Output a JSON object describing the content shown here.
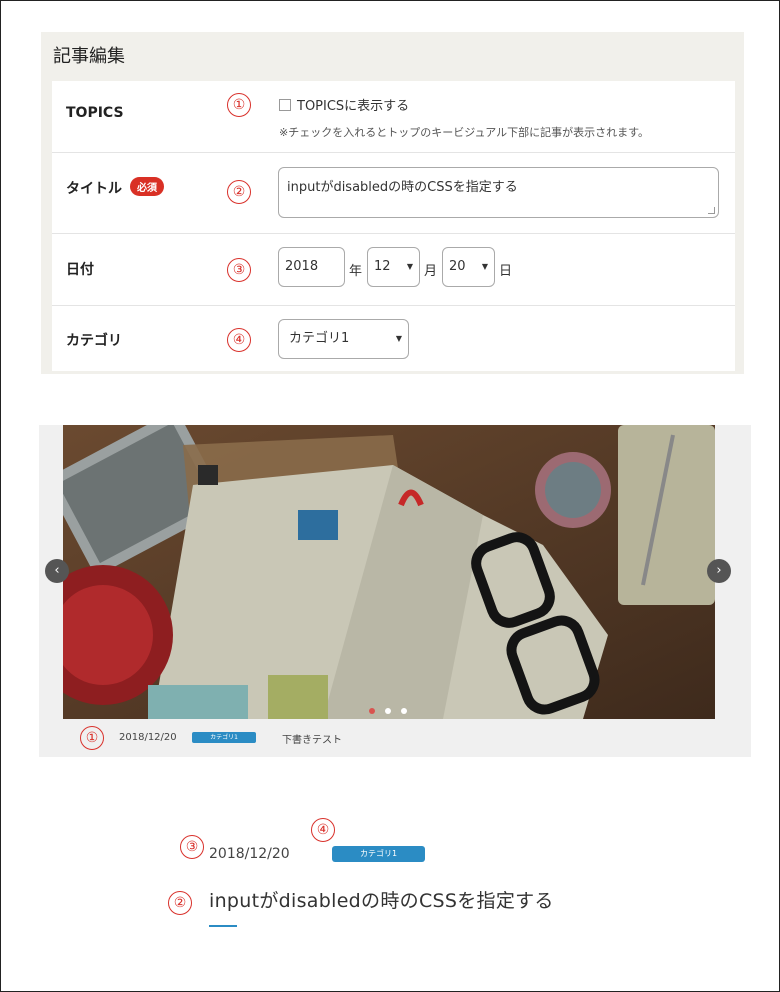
{
  "panel": {
    "title": "記事編集",
    "rows": [
      {
        "label": "TOPICS",
        "marker": "①",
        "checkbox_label": "TOPICSに表示する",
        "note": "※チェックを入れるとトップのキービジュアル下部に記事が表示されます。"
      },
      {
        "label": "タイトル",
        "marker": "②",
        "required_badge": "必須",
        "value": "inputがdisabledの時のCSSを指定する"
      },
      {
        "label": "日付",
        "marker": "③",
        "year": "2018",
        "year_unit": "年",
        "month": "12",
        "month_unit": "月",
        "day": "20",
        "day_unit": "日"
      },
      {
        "label": "カテゴリ",
        "marker": "④",
        "value": "カテゴリ1"
      }
    ]
  },
  "slider": {
    "prev_icon": "‹",
    "next_icon": "›",
    "dots": 3,
    "active_dot": 0,
    "accent": "#d9534f",
    "info": {
      "marker": "①",
      "date": "2018/12/20",
      "category": "カテゴリ1",
      "title": "下書きテスト"
    }
  },
  "article": {
    "marker_date": "③",
    "marker_category": "④",
    "marker_title": "②",
    "date": "2018/12/20",
    "category": "カテゴリ1",
    "title": "inputがdisabledの時のCSSを指定する"
  },
  "colors": {
    "marker_red": "#d9312b",
    "category_blue": "#2b8cc4",
    "required_red": "#d93025"
  }
}
